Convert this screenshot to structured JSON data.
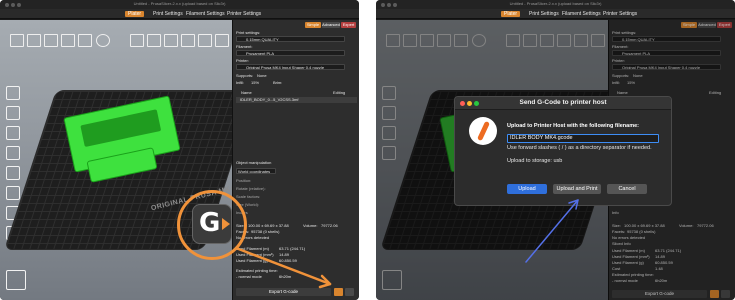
{
  "window": {
    "title": "Untitled - PrusaSlicer-2.x.x (upload based on Slic3r)"
  },
  "tabs": [
    {
      "label": "Plater"
    },
    {
      "label": "Print Settings"
    },
    {
      "label": "Filament Settings"
    },
    {
      "label": "Printer Settings"
    }
  ],
  "right_panel": {
    "modes": {
      "simple": "Simple",
      "advanced": "Advanced",
      "expert": "Expert"
    },
    "print_settings_label": "Print settings:",
    "print_profile": "0.15mm QUALITY",
    "filament_label": "Filament:",
    "filament_profile": "Prusament PLA",
    "printer_label": "Printer:",
    "printer_profile": "Original Prusa MK4 Input Shaper 0.4 nozzle",
    "supports_label": "Supports:",
    "supports_value": "None",
    "infill_label": "Infill:",
    "infill_value": "15%",
    "brim_label": "Brim:",
    "list_header_name": "Name",
    "list_header_editing": "Editing",
    "object_name": "IDLER_BODY_0...5_V2CSS.3mf",
    "object_manip_title": "Object manipulation",
    "world_coordinates": "World coordinates",
    "position_label": "Position:",
    "rotation_label": "Rotate (relative):",
    "scale_label": "Scale factors:",
    "size_label": "Size (World):",
    "inches_label": "Inches",
    "info_title": "Info",
    "info_size_label": "Size:",
    "info_size_value": "100.00 x 69.69 x 37.88",
    "info_volume_label": "Volume:",
    "info_volume_value": "79772.06",
    "info_facets_label": "Facets:",
    "info_facets_value": "95738 (0 shells)",
    "info_errors": "No errors detected",
    "sliced_info_title": "Sliced Info",
    "used_filament_m_label": "Used Filament (m)",
    "used_filament_m_value": "63.71 (244.71)",
    "used_filament_mm3_label": "Used Filament (mm³)",
    "used_filament_mm3_value": "14.89",
    "used_filament_g_label": "Used Filament (g)",
    "used_filament_g_value": "60.850.59",
    "cost_label": "Cost",
    "cost_value": "1.48",
    "print_time_label": "Estimated printing time:",
    "normal_mode_label": "- normal mode",
    "normal_mode_value": "6h20m",
    "export_button": "Export G-code"
  },
  "bed": {
    "brand": "ORIGINAL PRUSA MK4"
  },
  "callout": {
    "icon_letter": "G",
    "accent": "#f0923a"
  },
  "dialog": {
    "title": "Send G-Code to printer host",
    "prompt": "Upload to Printer Host with the following filename:",
    "filename": "IDLER BODY MK4.gcode",
    "hint": "Use forward slashes ( / ) as a directory separator if needed.",
    "storage": "Upload to storage: usb",
    "upload_button": "Upload",
    "upload_print_button": "Upload and Print",
    "cancel_button": "Cancel"
  },
  "colors": {
    "accent_orange": "#d9852e",
    "model_green": "#3ee13e",
    "dialog_blue": "#2f6fdc"
  }
}
